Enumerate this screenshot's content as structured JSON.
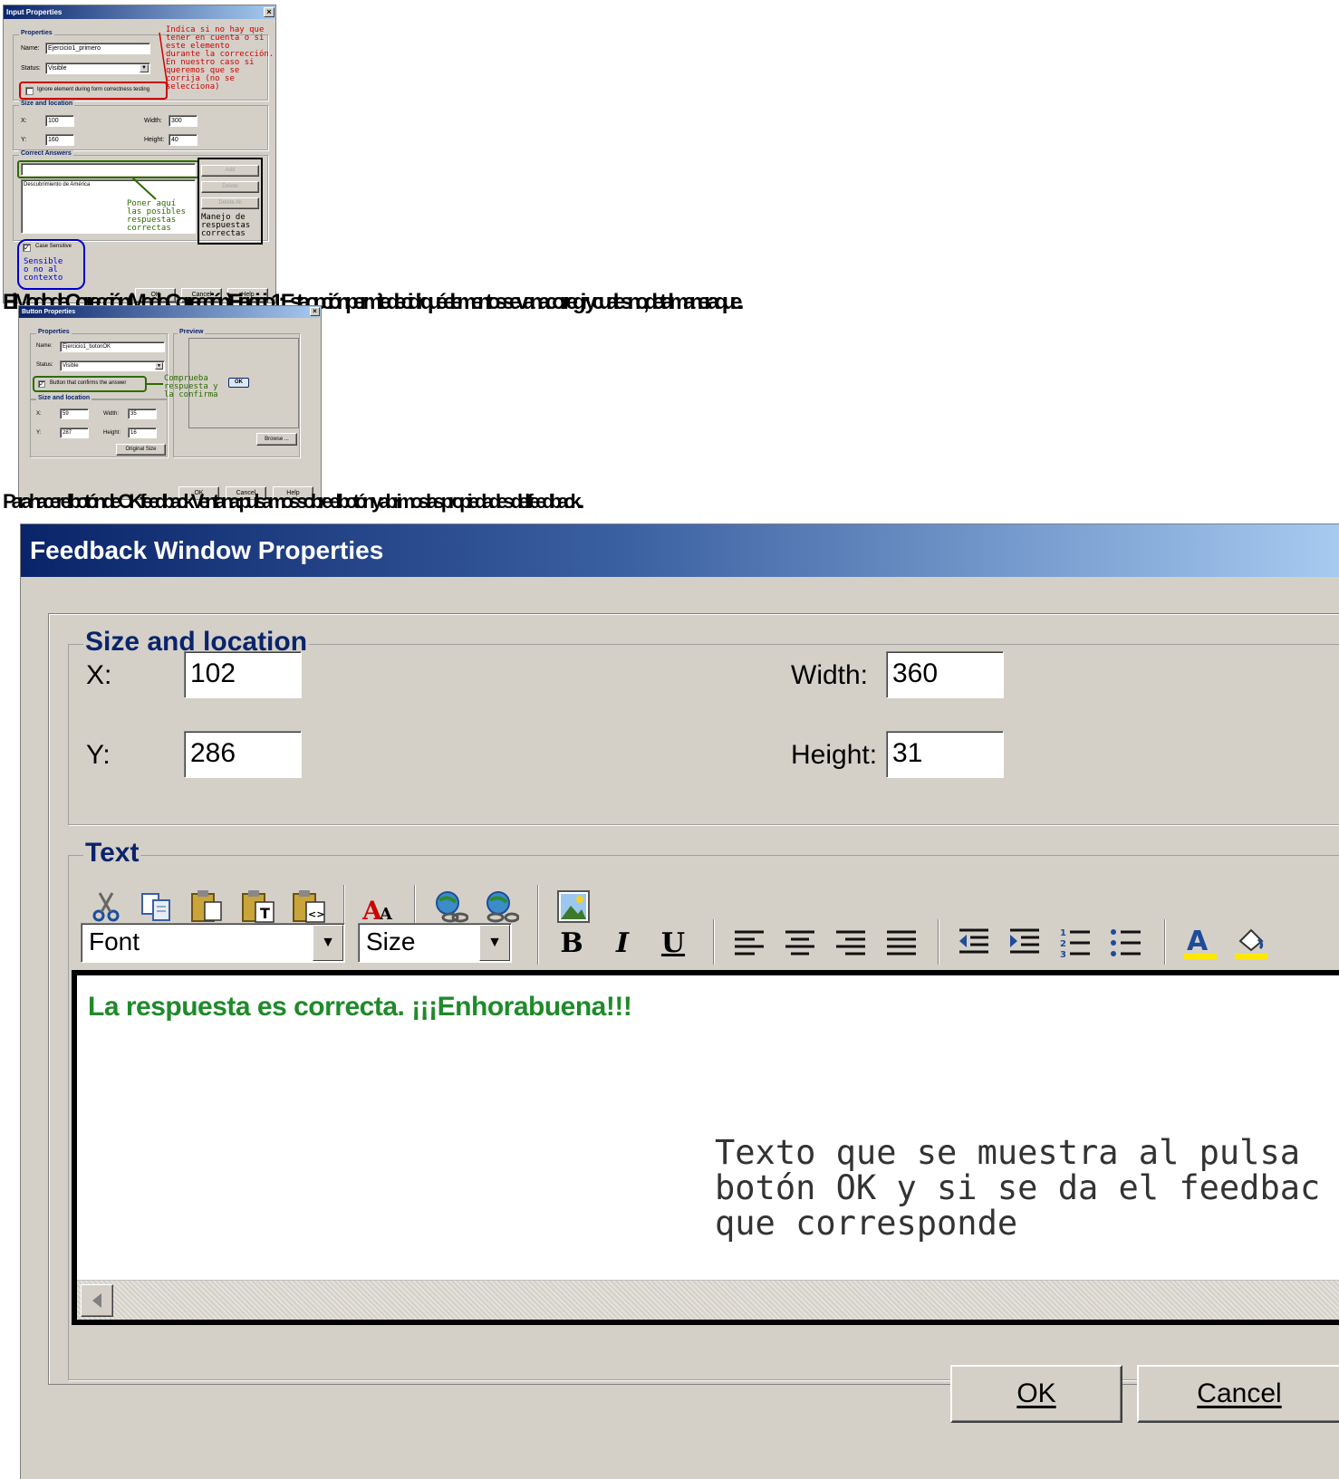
{
  "input_dialog": {
    "title": "Input Properties",
    "close": "×",
    "properties_group": "Properties",
    "name_label": "Name:",
    "name_value": "Ejercicio1_primero",
    "status_label": "Status:",
    "status_value": "Visible",
    "ignore_label": "Ignore element during form correctness testing",
    "ignore_checked": false,
    "size_group": "Size and location",
    "x_label": "X:",
    "x_value": "100",
    "y_label": "Y:",
    "y_value": "160",
    "width_label": "Width:",
    "width_value": "300",
    "height_label": "Height:",
    "height_value": "40",
    "correct_group": "Correct Answers",
    "answer_input_value": "",
    "answers_list": [
      "Descubrimiento de América"
    ],
    "add_button": "Add",
    "delete_button": "Delete",
    "delete_all_button": "Delete All",
    "case_label": "Case Sensitive",
    "case_checked": true,
    "ok_button": "OK",
    "cancel_button": "Cancel",
    "help_button": "Help",
    "ann_ignore": "Indica si no hay que\ntener en cuenta o si\neste elemento\ndurante la corrección.\nEn nuestro caso si\nqueremos que se\ncorrija (no se\nselecciona)",
    "ann_answers": "Poner aquí\nlas posibles\nrespuestas\ncorrectas",
    "ann_manage": "Manejo de\nrespuestas\ncorrectas",
    "ann_case": "Sensible\no no al\ncontexto",
    "ann_color_red": "#d00000",
    "ann_color_green": "#2e6b00",
    "ann_color_blue": "#0000cc"
  },
  "garbled_line_1": "El  Modo de Correcció n  (Modo Corrección ) Ejercicio 1 : Esta opció n  permite decidir qué elementos se van a corregir y cuales no,   de tal manera que...",
  "button_dialog": {
    "title": "Button Properties",
    "close": "×",
    "properties_group": "Properties",
    "name_label": "Name:",
    "name_value": "Ejercicio1_botonOK",
    "status_label": "Status:",
    "status_value": "Visible",
    "confirm_label": "Button that confirms the answer",
    "confirm_checked": true,
    "size_group": "Size and location",
    "x_label": "X:",
    "x_value": "59",
    "y_label": "Y:",
    "y_value": "287",
    "width_label": "Width:",
    "width_value": "35",
    "height_label": "Height:",
    "height_value": "16",
    "original_size_button": "Original Size",
    "preview_group": "Preview",
    "browse_button": "Browse ...",
    "ok_preview": "OK",
    "ok_button": "OK",
    "cancel_button": "Cancel",
    "help_button": "Help",
    "ann_confirm": "Comprueba\nrespuesta y\nla confirma"
  },
  "garbled_line_2": "Para hacer el botón de OK feedback Ventana: pulsamos sobre el botón y abrimos las propiedades del feedback...",
  "feedback_dialog": {
    "title": "Feedback Window Properties",
    "size_group": "Size and location",
    "x_label": "X:",
    "x_value": "102",
    "y_label": "Y:",
    "y_value": "286",
    "width_label": "Width:",
    "width_value": "360",
    "height_label": "Height:",
    "height_value": "31",
    "text_group": "Text",
    "font_placeholder": "Font",
    "size_placeholder": "Size",
    "bold": "B",
    "italic": "I",
    "underline": "U",
    "editor_text": "La respuesta es correcta. ¡¡¡Enhorabuena!!!",
    "editor_color": "#1f8a2a",
    "annotation": "Texto que se muestra al pulsa\nbotón OK y si se da el feedbac\nque corresponde",
    "ok_button": "OK",
    "cancel_button": "Cancel"
  }
}
